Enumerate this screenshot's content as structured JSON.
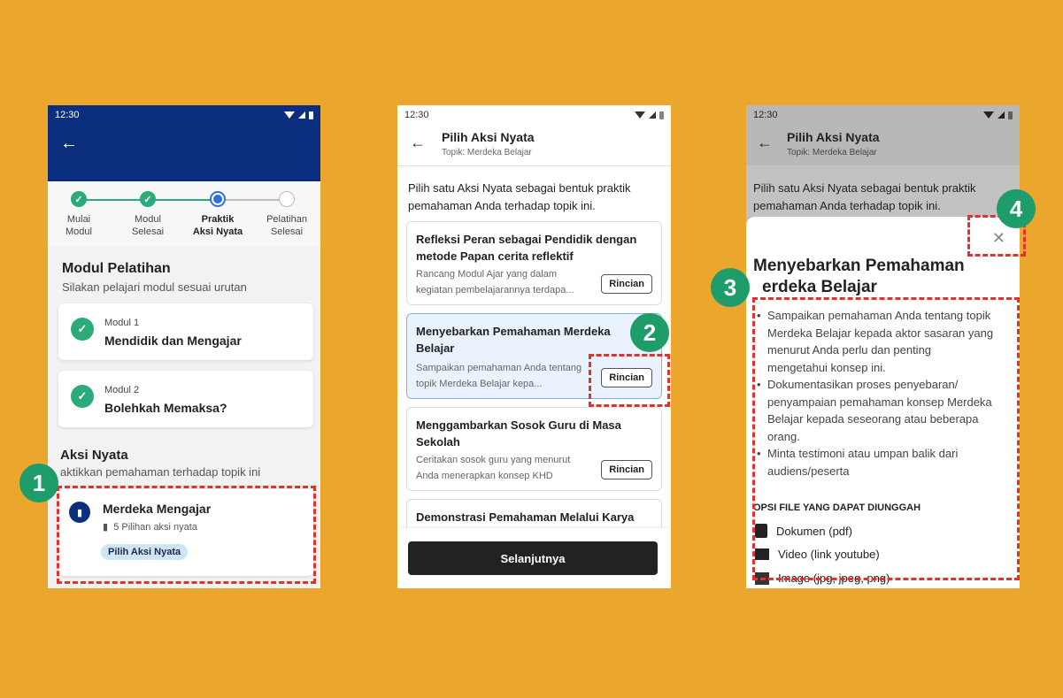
{
  "colors": {
    "background": "#EBA62E",
    "header": "#0B2F7E",
    "green": "#2BAA7A",
    "marker": "#1E9C6A",
    "dashed": "#E0322E",
    "primary_button": "#222222"
  },
  "statusbar": {
    "time": "12:30"
  },
  "screen1": {
    "steps": [
      {
        "label": "Mulai Modul",
        "state": "done"
      },
      {
        "label": "Modul Selesai",
        "state": "done"
      },
      {
        "label": "Praktik Aksi Nyata",
        "state": "current"
      },
      {
        "label": "Pelatihan Selesai",
        "state": "todo"
      }
    ],
    "section_title": "Modul Pelatihan",
    "section_subtitle": "Silakan pelajari modul sesuai urutan",
    "modules": [
      {
        "number": "Modul 1",
        "title": "Mendidik dan Mengajar"
      },
      {
        "number": "Modul 2",
        "title": "Bolehkah Memaksa?"
      }
    ],
    "aksi_title": "Aksi Nyata",
    "aksi_subtitle": "aktikkan pemahaman terhadap topik ini",
    "aksi_card": {
      "title": "Merdeka Mengajar",
      "meta": "5 Pilihan aksi nyata",
      "button": "Pilih Aksi Nyata"
    }
  },
  "screen2": {
    "title": "Pilih Aksi Nyata",
    "subtitle": "Topik: Merdeka Belajar",
    "intro": "Pilih satu Aksi Nyata sebagai bentuk praktik pemahaman Anda terhadap topik ini.",
    "options": [
      {
        "title": "Refleksi Peran sebagai Pendidik dengan metode Papan cerita reflektif",
        "desc": "Rancang Modul Ajar yang dalam kegiatan pembelajarannya terdapa..."
      },
      {
        "title": "Menyebarkan Pemahaman Merdeka Belajar",
        "desc": "Sampaikan pemahaman Anda tentang topik Merdeka Belajar kepa..."
      },
      {
        "title": "Menggambarkan Sosok Guru di Masa Sekolah",
        "desc": "Ceritakan sosok guru yang menurut Anda menerapkan konsep KHD"
      },
      {
        "title": "Demonstrasi Pemahaman Melalui Karya",
        "desc": ""
      }
    ],
    "detail_button": "Rincian",
    "next_button": "Selanjutnya"
  },
  "screen3": {
    "title": "Pilih Aksi Nyata",
    "subtitle": "Topik: Merdeka Belajar",
    "intro": "Pilih satu Aksi Nyata sebagai bentuk praktik pemahaman Anda terhadap topik ini.",
    "sheet_title": "Menyebarkan Pemahaman Merdeka Belajar",
    "sheet_title_visible": "Menyebarkan Pemahaman",
    "sheet_title_line2": "erdeka Belajar",
    "bullets": [
      "Sampaikan pemahaman Anda tentang topik Merdeka Belajar kepada aktor sasaran yang menurut Anda perlu dan penting mengetahui konsep ini.",
      "Dokumentasikan proses penyebaran/ penyampaian pemahaman konsep Merdeka Belajar kepada seseorang atau beberapa orang.",
      "Minta testimoni atau umpan balik dari audiens/peserta"
    ],
    "file_heading": "OPSI FILE YANG DAPAT DIUNGGAH",
    "files": [
      {
        "label": "Dokumen (pdf)",
        "icon": "document-icon"
      },
      {
        "label": "Video (link youtube)",
        "icon": "video-icon"
      },
      {
        "label": "Image (jpg, jpeg, png)",
        "icon": "image-icon"
      }
    ]
  },
  "markers": [
    "1",
    "2",
    "3",
    "4"
  ]
}
